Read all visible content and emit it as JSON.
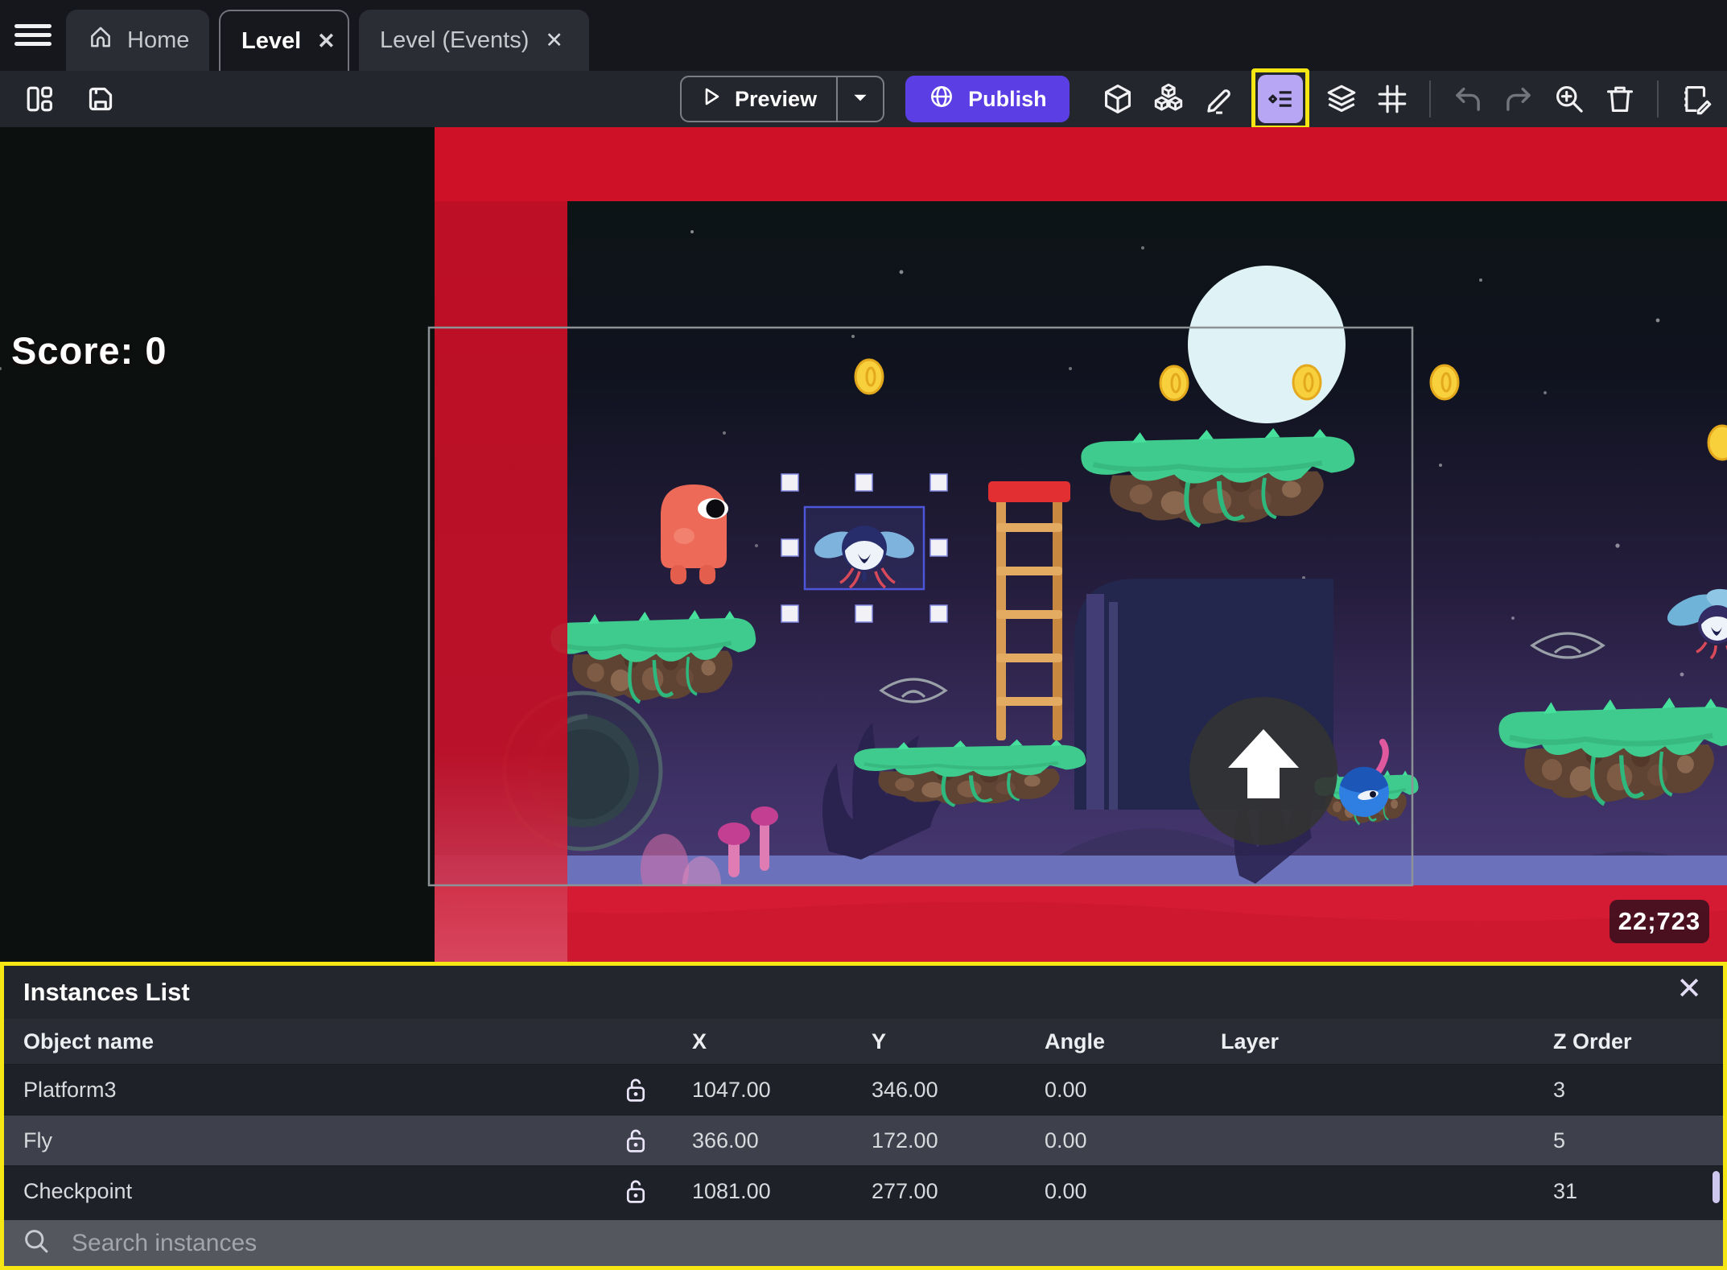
{
  "tabs": {
    "home": "Home",
    "level": "Level",
    "level_events": "Level (Events)"
  },
  "glyphs": {
    "close": "✕"
  },
  "toolbar": {
    "preview_label": "Preview",
    "publish_label": "Publish",
    "icons": [
      "panels-icon",
      "save-icon",
      "play-icon",
      "caret-down-icon",
      "globe-icon",
      "box-icon",
      "boxes-icon",
      "pencil-icon",
      "instances-list-icon",
      "layers-icon",
      "grid-icon",
      "undo-icon",
      "redo-icon",
      "zoom-in-icon",
      "trash-icon",
      "scene-edit-icon"
    ],
    "highlighted_icon": "instances-list-icon"
  },
  "canvas": {
    "score_text": "Score: 0",
    "coords_badge": "22;723",
    "selected_instance": "Fly"
  },
  "panel": {
    "title": "Instances List",
    "columns": {
      "object_name": "Object name",
      "x": "X",
      "y": "Y",
      "angle": "Angle",
      "layer": "Layer",
      "z_order": "Z Order"
    },
    "rows": [
      {
        "name": "Platform3",
        "x": "1047.00",
        "y": "346.00",
        "angle": "0.00",
        "layer": "",
        "z_order": "3"
      },
      {
        "name": "Fly",
        "x": "366.00",
        "y": "172.00",
        "angle": "0.00",
        "layer": "",
        "z_order": "5"
      },
      {
        "name": "Checkpoint",
        "x": "1081.00",
        "y": "277.00",
        "angle": "0.00",
        "layer": "",
        "z_order": "31"
      }
    ],
    "selected_row_index": 1,
    "search_placeholder": "Search instances"
  },
  "colors": {
    "accent_purple": "#5b3fe4",
    "highlight_yellow": "#f6e714",
    "selection_blue": "#4d55d8",
    "red_band": "#ce1126",
    "selected_row": "#3e414c",
    "instances_icon_bg": "#b7a6f4"
  }
}
